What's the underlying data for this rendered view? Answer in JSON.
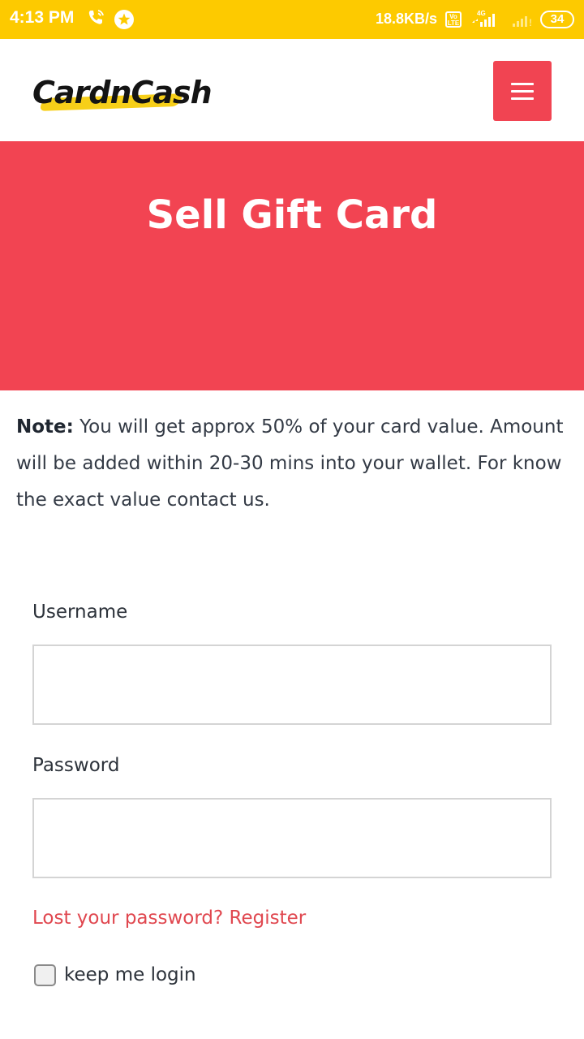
{
  "status_bar": {
    "time": "4:13 PM",
    "network_speed": "18.8KB/s",
    "volte": "VoLTE",
    "network_type": "4G",
    "battery": "34",
    "icons": [
      "wifi-call-icon",
      "star-badge-icon",
      "volte-icon",
      "signal-icon",
      "no-signal-icon",
      "battery-icon"
    ]
  },
  "header": {
    "logo_text": "CardnCash",
    "menu_icon": "hamburger-icon",
    "accent_color": "#f24452",
    "logo_swoosh_color": "#f7cf19"
  },
  "banner": {
    "title": "Sell Gift Card"
  },
  "note": {
    "label": "Note:",
    "text": " You will get approx 50% of your card value. Amount will be added within 20-30 mins into your wallet. For know the exact value contact us."
  },
  "form": {
    "username_label": "Username",
    "username_value": "",
    "password_label": "Password",
    "password_value": "",
    "lost_password_text": "Lost your password? Register",
    "remember_label": "keep me login",
    "remember_checked": false
  }
}
